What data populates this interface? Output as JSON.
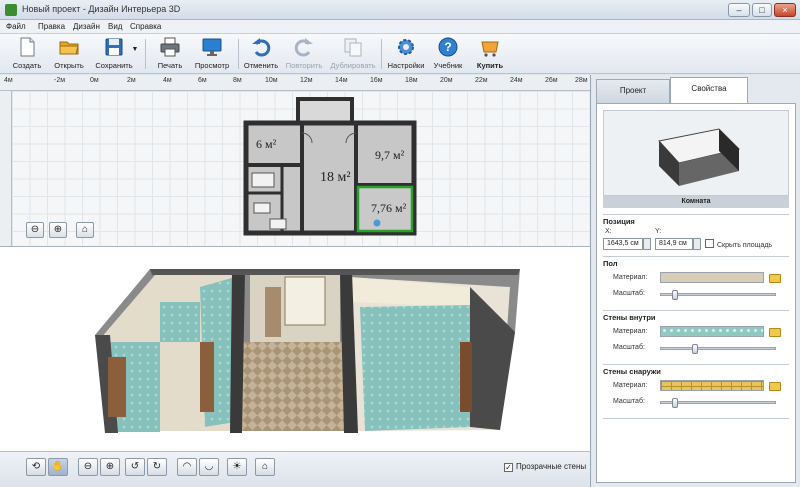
{
  "window": {
    "title": "Новый проект - Дизайн Интерьера 3D",
    "controls": [
      "–",
      "□",
      "×"
    ]
  },
  "menu": [
    "Файл",
    "Правка",
    "Дизайн",
    "Вид",
    "Справка"
  ],
  "toolbar": {
    "items": [
      {
        "label": "Создать",
        "icon": "new-file-icon"
      },
      {
        "label": "Открыть",
        "icon": "folder-open-icon"
      },
      {
        "label": "Сохранить",
        "icon": "save-icon"
      },
      {
        "label": "Печать",
        "icon": "printer-icon"
      },
      {
        "label": "Просмотр",
        "icon": "monitor-icon"
      },
      {
        "label": "Отменить",
        "icon": "undo-icon"
      },
      {
        "label": "Повторить",
        "icon": "redo-icon",
        "disabled": true
      },
      {
        "label": "Дублировать",
        "icon": "duplicate-icon",
        "disabled": true
      },
      {
        "label": "Настройки",
        "icon": "gear-icon"
      },
      {
        "label": "Учебник",
        "icon": "help-icon"
      },
      {
        "label": "Купить",
        "icon": "cart-icon"
      }
    ]
  },
  "ruler": {
    "labels": [
      "4м",
      "-2м",
      "0м",
      "2м",
      "4м",
      "6м",
      "8м",
      "10м",
      "12м",
      "14м",
      "16м",
      "18м",
      "20м",
      "22м",
      "24м",
      "26м",
      "28м"
    ]
  },
  "plan": {
    "rooms": [
      {
        "label": "6 м²"
      },
      {
        "label": "18 м²"
      },
      {
        "label": "9,7 м²"
      },
      {
        "label": "7,76 м²"
      }
    ],
    "buttons": [
      {
        "name": "zoom-out-button",
        "icon": "zoom-out-icon",
        "glyph": "⊖"
      },
      {
        "name": "zoom-in-button",
        "icon": "zoom-in-icon",
        "glyph": "⊕"
      },
      {
        "name": "home-button",
        "icon": "home-icon",
        "glyph": "⌂"
      }
    ]
  },
  "view3d": {
    "toolbar_icons": [
      "rotate-icon",
      "hand-icon",
      "zoom-out-icon",
      "zoom-in-icon",
      "rotate-left-icon",
      "rotate-right-icon",
      "tilt-up-icon",
      "tilt-down-icon",
      "light-icon",
      "home-icon"
    ],
    "transparent_walls_label": "Прозрачные стены",
    "transparent_walls_checked": true
  },
  "panel": {
    "tabs": [
      "Проект",
      "Свойства"
    ],
    "active_tab": "Свойства",
    "preview_caption": "Комната",
    "position": {
      "title": "Позиция",
      "x_label": "X:",
      "y_label": "Y:",
      "x_value": "1643,5 см",
      "y_value": "814,9 см",
      "hide_area_label": "Скрыть площадь"
    },
    "floor": {
      "title": "Пол",
      "material_label": "Материал:",
      "scale_label": "Масштаб:",
      "scale_value": 0.12
    },
    "walls_inside": {
      "title": "Стены внутри",
      "material_label": "Материал:",
      "scale_label": "Масштаб:",
      "scale_value": 0.3
    },
    "walls_outside": {
      "title": "Стены снаружи",
      "material_label": "Материал:",
      "scale_label": "Масштаб:",
      "scale_value": 0.12
    }
  },
  "colors": {
    "room_selected": "#27a127",
    "wall": "#2f2f2f",
    "room_fill": "#c7c7c7",
    "wallpaper": "#7fb8b4",
    "floor_tile": "#b9a789"
  }
}
